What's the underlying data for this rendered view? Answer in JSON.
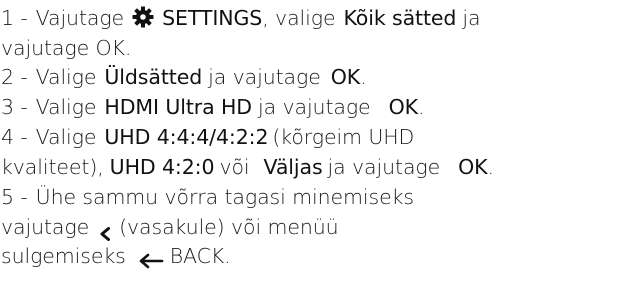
{
  "instructions": {
    "step1": {
      "num": "1 -",
      "pre": "Vajutage",
      "icon": "settings-gear-icon",
      "settings_label": "SETTINGS",
      "mid": ", valige",
      "all_settings": "Kõik sätted",
      "ja": "ja",
      "cont": "vajutage OK."
    },
    "step2": {
      "num": "2 -",
      "pre": "Valige",
      "general": "Üldsätted",
      "mid": "ja vajutage",
      "ok": "OK",
      "end": "."
    },
    "step3": {
      "num": "3 -",
      "pre": "Valige",
      "hdmi": "HDMI Ultra HD",
      "mid": "ja vajutage",
      "ok": "OK",
      "end": "."
    },
    "step4": {
      "num": "4 -",
      "pre": "Valige",
      "uhd444": "UHD 4:4:4/4:2:2",
      "paren_start": "(kõrgeim UHD",
      "paren_end": "kvaliteet),",
      "uhd420": "UHD 4:2:0",
      "voi": "või",
      "off": "Väljas",
      "mid": "ja vajutage",
      "ok": "OK",
      "end": "."
    },
    "step5": {
      "num": "5 -",
      "line1": "Ühe sammu võrra tagasi minemiseks",
      "pre": "vajutage",
      "left_icon": "chevron-left-icon",
      "left_text": "(vasakule) või menüü",
      "close": "sulgemiseks",
      "back_icon": "back-arrow-icon",
      "back_label": "BACK."
    }
  }
}
